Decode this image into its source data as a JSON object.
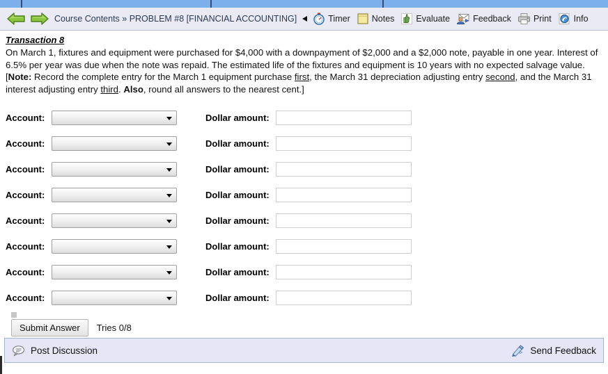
{
  "browser": {
    "tabs_visible": 4
  },
  "navbar": {
    "back_icon": "back-arrow-icon",
    "forward_icon": "forward-arrow-icon",
    "breadcrumb": "Course Contents » PROBLEM #8 [FINANCIAL ACCOUNTING]",
    "tools": [
      {
        "label": "Timer",
        "icon": "stopwatch-icon"
      },
      {
        "label": "Notes",
        "icon": "notepad-icon"
      },
      {
        "label": "Evaluate",
        "icon": "thumbs-up-icon"
      },
      {
        "label": "Feedback",
        "icon": "envelope-person-icon"
      },
      {
        "label": "Print",
        "icon": "printer-icon"
      },
      {
        "label": "Info",
        "icon": "info-globe-icon"
      }
    ]
  },
  "problem": {
    "title": "Transaction 8",
    "body_part1": "On March 1, fixtures and equipment were purchased for $4,000 with a downpayment of $2,000 and a $2,000 note, payable in one year. Interest of 6.5% per year was due when the note was repaid. The estimated life of the fixtures and equipment is 10 years with no expected salvage value. [",
    "note_label": "Note:",
    "body_part2": " Record the complete entry for the March 1 equipment purchase ",
    "ordinal_first": "first",
    "body_part3": ", the March 31 depreciation adjusting entry ",
    "ordinal_second": "second",
    "body_part4": ", and the March 31 interest adjusting entry ",
    "ordinal_third": "third",
    "body_part5": ". ",
    "also_label": "Also",
    "body_part6": ", round all answers to the nearest cent.]"
  },
  "form": {
    "account_label": "Account:",
    "dollar_label": "Dollar amount:",
    "account_placeholder": "",
    "amount_placeholder": "",
    "rows": [
      {
        "account_value": "",
        "amount_value": ""
      },
      {
        "account_value": "",
        "amount_value": ""
      },
      {
        "account_value": "",
        "amount_value": ""
      },
      {
        "account_value": "",
        "amount_value": ""
      },
      {
        "account_value": "",
        "amount_value": ""
      },
      {
        "account_value": "",
        "amount_value": ""
      },
      {
        "account_value": "",
        "amount_value": ""
      },
      {
        "account_value": "",
        "amount_value": ""
      }
    ]
  },
  "submit": {
    "button_label": "Submit Answer",
    "tries_text": "Tries 0/8"
  },
  "footer": {
    "post_discussion_label": "Post Discussion",
    "post_discussion_icon": "speech-bubble-icon",
    "send_feedback_label": "Send Feedback",
    "send_feedback_icon": "feedback-pencil-icon"
  },
  "colors": {
    "tab_blue": "#7cb0ec",
    "navbar_bg": "#e9eaf3",
    "footer_bg": "#e6e6f7",
    "footer_border": "#9fb6cd",
    "breadcrumb_text": "#2b3a52",
    "arrow_green": "#8cc63f"
  }
}
